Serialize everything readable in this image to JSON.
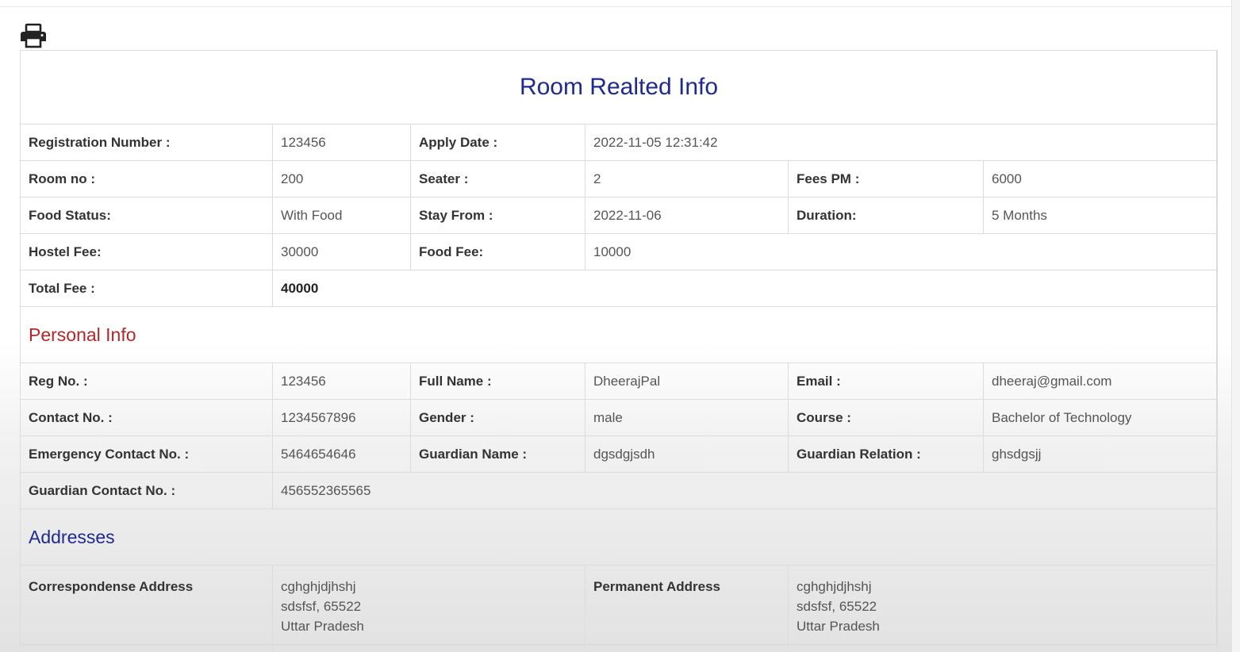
{
  "title": "Room Realted Info",
  "print_icon": "printer-icon",
  "room": {
    "registration_number_label": "Registration Number :",
    "registration_number": "123456",
    "apply_date_label": "Apply Date :",
    "apply_date": "2022-11-05 12:31:42",
    "room_no_label": "Room no :",
    "room_no": "200",
    "seater_label": "Seater :",
    "seater": "2",
    "fees_pm_label": "Fees PM :",
    "fees_pm": "6000",
    "food_status_label": "Food Status:",
    "food_status": "With Food",
    "stay_from_label": "Stay From :",
    "stay_from": "2022-11-06",
    "duration_label": "Duration:",
    "duration": "5 Months",
    "hostel_fee_label": "Hostel Fee:",
    "hostel_fee": "30000",
    "food_fee_label": "Food Fee:",
    "food_fee": "10000",
    "total_fee_label": "Total Fee :",
    "total_fee": "40000"
  },
  "personal": {
    "heading": "Personal Info",
    "reg_no_label": "Reg No. :",
    "reg_no": "123456",
    "full_name_label": "Full Name :",
    "full_name": "DheerajPal",
    "email_label": "Email :",
    "email": "dheeraj@gmail.com",
    "contact_label": "Contact No. :",
    "contact": "1234567896",
    "gender_label": "Gender :",
    "gender": "male",
    "course_label": "Course :",
    "course": "Bachelor of Technology",
    "emergency_label": "Emergency Contact No. :",
    "emergency": "5464654646",
    "guardian_name_label": "Guardian Name :",
    "guardian_name": "dgsdgjsdh",
    "guardian_relation_label": "Guardian Relation :",
    "guardian_relation": "ghsdgsjj",
    "guardian_contact_label": "Guardian Contact No. :",
    "guardian_contact": "456552365565"
  },
  "addresses": {
    "heading": "Addresses",
    "correspondence_label": "Correspondense Address",
    "correspondence": [
      "cghghjdjhshj",
      "sdsfsf, 65522",
      "Uttar Pradesh"
    ],
    "permanent_label": "Permanent Address",
    "permanent": [
      "cghghjdjhshj",
      "sdsfsf, 65522",
      "Uttar Pradesh"
    ]
  },
  "colors": {
    "title_blue": "#1f2a8c",
    "section_red": "#b0272b"
  }
}
